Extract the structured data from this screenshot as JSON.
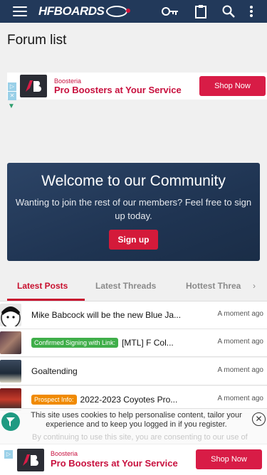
{
  "header": {
    "logo_text": "HFBOARDS",
    "icons": [
      "menu-icon",
      "key-icon",
      "clipboard-icon",
      "search-icon",
      "more-vertical-icon"
    ]
  },
  "page": {
    "title": "Forum list"
  },
  "ad": {
    "brand": "Boosteria",
    "headline": "Pro Boosters at Your Service",
    "cta": "Shop Now",
    "logo_text": "B"
  },
  "welcome": {
    "title": "Welcome to our Community",
    "text": "Wanting to join the rest of our members? Feel free to sign up today.",
    "signup_label": "Sign up"
  },
  "tabs": {
    "items": [
      {
        "label": "Latest Posts",
        "active": true
      },
      {
        "label": "Latest Threads",
        "active": false
      },
      {
        "label": "Hottest Threads",
        "active": false
      }
    ],
    "visible_third": "Hottest Threa",
    "arrow": "›"
  },
  "posts": [
    {
      "label": "",
      "label_color": "",
      "title": "Mike Babcock will be the new Blue Ja...",
      "time": "A moment ago"
    },
    {
      "label": "Confirmed Signing with Link:",
      "label_color": "#3fae49",
      "title": "[MTL] F Col...",
      "time": "A moment ago"
    },
    {
      "label": "",
      "label_color": "",
      "title": "Goaltending",
      "time": "A moment ago"
    },
    {
      "label": "Prospect Info:",
      "label_color": "#f08a00",
      "title": "2022-2023 Coyotes Pro...",
      "time": "A moment ago"
    }
  ],
  "cookie": {
    "text": "This site uses cookies to help personalise content, tailor your experience and to keep you logged in if you register.",
    "faded_text": "By continuing to use this site, you are consenting to our use of",
    "close": "✕"
  },
  "colors": {
    "header_bg": "#22395a",
    "accent_red": "#c8102e",
    "welcome_bg": "#1f3452"
  }
}
